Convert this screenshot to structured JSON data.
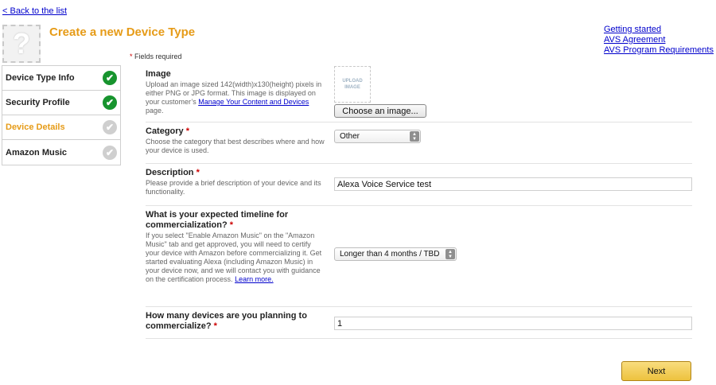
{
  "nav": {
    "back_link": "< Back to the list",
    "top_links": [
      "Getting started",
      "AVS Agreement",
      "AVS Program Requirements"
    ]
  },
  "header": {
    "placeholder_glyph": "?",
    "title": "Create a new Device Type",
    "required_note": "Fields required",
    "required_mark": "*"
  },
  "steps": [
    {
      "label": "Device Type Info",
      "status": "complete"
    },
    {
      "label": "Security Profile",
      "status": "complete"
    },
    {
      "label": "Device Details",
      "status": "active"
    },
    {
      "label": "Amazon Music",
      "status": "pending"
    }
  ],
  "form": {
    "image": {
      "label": "Image",
      "help_prefix": "Upload an image sized 142(width)x130(height) pixels in either PNG or JPG format. This image is displayed on your customer’s ",
      "help_link": "Manage Your Content and Devices",
      "help_suffix": " page.",
      "upload_placeholder": "UPLOAD IMAGE",
      "choose_button": "Choose an image..."
    },
    "category": {
      "label": "Category",
      "help": "Choose the category that best describes where and how your device is used.",
      "selected": "Other"
    },
    "description": {
      "label": "Description",
      "help": "Please provide a brief description of your device and its functionality.",
      "value": "Alexa Voice Service test"
    },
    "timeline": {
      "label": "What is your expected timeline for commercialization?",
      "help": "If you select \"Enable Amazon Music\" on the \"Amazon Music\" tab and get approved, you will need to certify your device with Amazon before commercializing it. Get started evaluating Alexa (including Amazon Music) in your device now, and we will contact you with guidance on the certification process. ",
      "help_link": "Learn more.",
      "selected": "Longer than 4 months / TBD"
    },
    "count": {
      "label": "How many devices are you planning to commercialize?",
      "value": "1"
    }
  },
  "footer": {
    "next_button": "Next"
  },
  "colors": {
    "accent": "#e69b17",
    "complete": "#17942e",
    "pending": "#cfcfcf",
    "link": "#0000cc"
  }
}
